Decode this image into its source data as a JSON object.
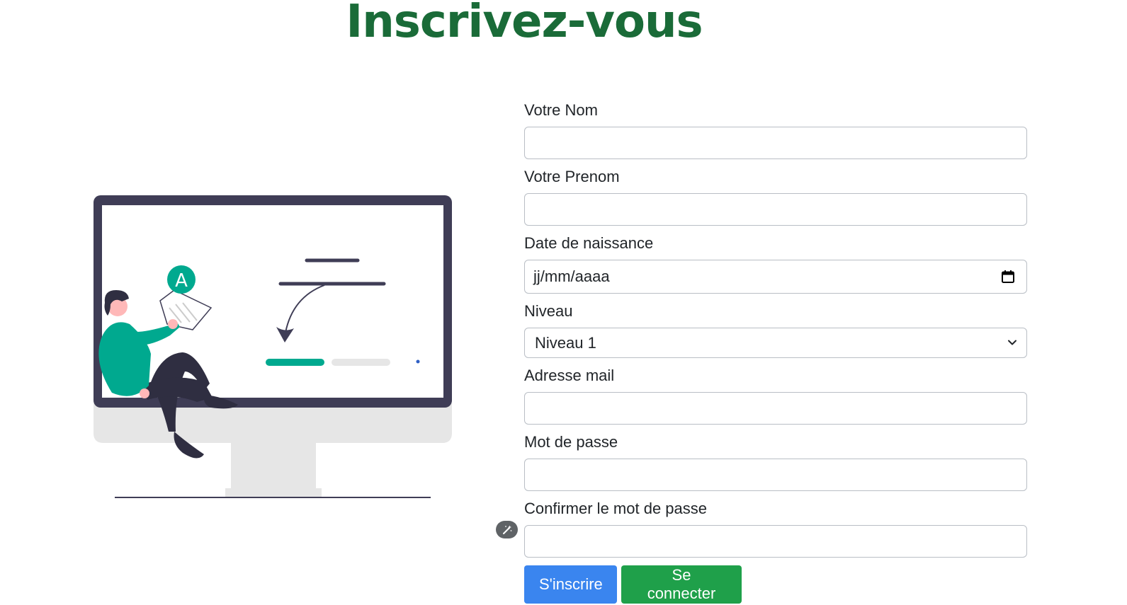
{
  "page": {
    "title": "Inscrivez-vous"
  },
  "illustration": {
    "badge_letter": "A"
  },
  "form": {
    "fields": [
      {
        "label": "Votre Nom",
        "value": ""
      },
      {
        "label": "Votre Prenom",
        "value": ""
      },
      {
        "label": "Date de naissance",
        "placeholder": "jj/mm/aaaa"
      },
      {
        "label": "Niveau",
        "selected": "Niveau 1"
      },
      {
        "label": "Adresse mail",
        "value": ""
      },
      {
        "label": "Mot de passe",
        "value": ""
      },
      {
        "label": "Confirmer le mot de passe",
        "value": ""
      }
    ],
    "submit_label": "S'inscrire",
    "login_label": "Se connecter"
  },
  "colors": {
    "title": "#1a6b38",
    "primary": "#3a85ef",
    "success": "#1fa04a",
    "accent": "#00a98f",
    "screen_frame": "#3f3d56"
  },
  "icons": [
    "calendar-icon",
    "chevron-down-icon",
    "password-helper-icon"
  ]
}
